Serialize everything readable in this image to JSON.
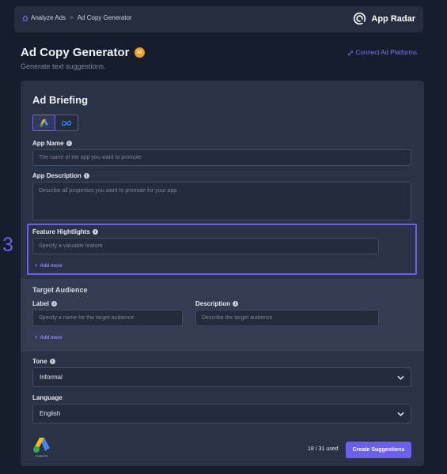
{
  "breadcrumb": {
    "home": "Analyze Ads",
    "separator": ">",
    "current": "Ad Copy Generator"
  },
  "brand": {
    "name": "App Radar",
    "icon": "app-radar-logo"
  },
  "header": {
    "title": "Ad Copy Generator",
    "badge": "AI",
    "subtitle": "Generate text suggestions.",
    "connect_link": "Connect Ad Platforms"
  },
  "briefing": {
    "title": "Ad Briefing",
    "platforms": [
      {
        "name": "google-ads",
        "active": true
      },
      {
        "name": "meta",
        "active": false
      }
    ],
    "app_name": {
      "label": "App Name",
      "placeholder": "The name of the app you want to promote"
    },
    "app_description": {
      "label": "App Description",
      "placeholder": "Describe all properties you want to promote for your app"
    },
    "feature_highlights": {
      "label": "Feature Hightlights",
      "placeholder": "Specify a valuable feature",
      "add_more": "Add more",
      "step_marker": "3"
    },
    "target_audience": {
      "title": "Target Audience",
      "label_field": {
        "label": "Label",
        "placeholder": "Specify a name for the target audience"
      },
      "description_field": {
        "label": "Description",
        "placeholder": "Describe the target audience"
      },
      "add_more": "Add more"
    },
    "tone": {
      "label": "Tone",
      "value": "Informal"
    },
    "language": {
      "label": "Language",
      "value": "English"
    }
  },
  "footer": {
    "logo_caption": "Google Ads",
    "usage": "18 / 31 used",
    "create_button": "Create Suggestions"
  },
  "colors": {
    "accent": "#6a5ff5",
    "background": "#161d2c",
    "card": "#2a3245",
    "badge": "#f59f1d"
  }
}
